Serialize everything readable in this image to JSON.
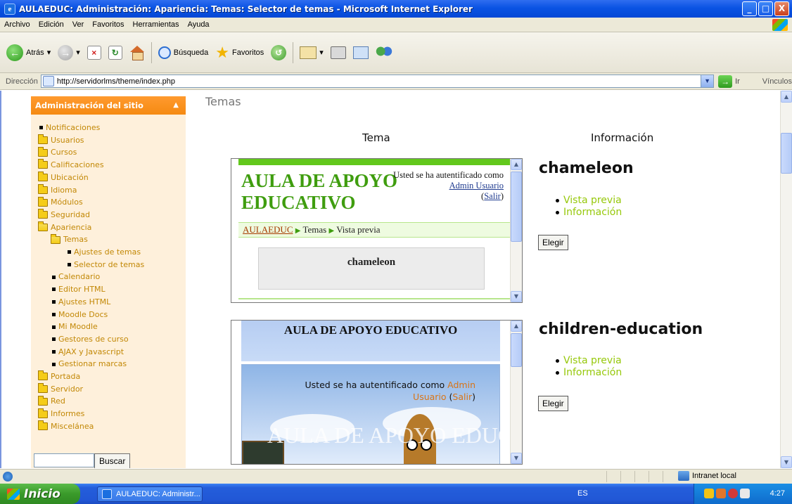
{
  "window": {
    "title": "AULAEDUC: Administración: Apariencia: Temas: Selector de temas - Microsoft Internet Explorer",
    "buttons": {
      "minimize": "_",
      "maximize": "□",
      "close": "X"
    }
  },
  "menu": [
    "Archivo",
    "Edición",
    "Ver",
    "Favoritos",
    "Herramientas",
    "Ayuda"
  ],
  "toolbar": {
    "back_label": "Atrás",
    "search_label": "Búsqueda",
    "favorites_label": "Favoritos"
  },
  "address": {
    "label": "Dirección",
    "url": "http://servidorlms/theme/index.php",
    "go_label": "Ir",
    "links_label": "Vínculos"
  },
  "sidebar": {
    "title": "Administración del sitio",
    "items": [
      {
        "label": "Notificaciones",
        "icon": "bullet",
        "level": 0
      },
      {
        "label": "Usuarios",
        "icon": "folder",
        "level": 0
      },
      {
        "label": "Cursos",
        "icon": "folder",
        "level": 0
      },
      {
        "label": "Calificaciones",
        "icon": "folder",
        "level": 0
      },
      {
        "label": "Ubicación",
        "icon": "folder",
        "level": 0
      },
      {
        "label": "Idioma",
        "icon": "folder",
        "level": 0
      },
      {
        "label": "Módulos",
        "icon": "folder",
        "level": 0
      },
      {
        "label": "Seguridad",
        "icon": "folder",
        "level": 0
      },
      {
        "label": "Apariencia",
        "icon": "folder-open",
        "level": 0
      },
      {
        "label": "Temas",
        "icon": "folder-open",
        "level": 1
      },
      {
        "label": "Ajustes de temas",
        "icon": "bullet",
        "level": 2
      },
      {
        "label": "Selector de temas",
        "icon": "bullet",
        "level": 2
      },
      {
        "label": "Calendario",
        "icon": "bullet",
        "level": 1
      },
      {
        "label": "Editor HTML",
        "icon": "bullet",
        "level": 1
      },
      {
        "label": "Ajustes HTML",
        "icon": "bullet",
        "level": 1
      },
      {
        "label": "Moodle Docs",
        "icon": "bullet",
        "level": 1
      },
      {
        "label": "Mi Moodle",
        "icon": "bullet",
        "level": 1
      },
      {
        "label": "Gestores de curso",
        "icon": "bullet",
        "level": 1
      },
      {
        "label": "AJAX y Javascript",
        "icon": "bullet",
        "level": 1
      },
      {
        "label": "Gestionar marcas",
        "icon": "bullet",
        "level": 1
      },
      {
        "label": "Portada",
        "icon": "folder",
        "level": 0
      },
      {
        "label": "Servidor",
        "icon": "folder",
        "level": 0
      },
      {
        "label": "Red",
        "icon": "folder",
        "level": 0
      },
      {
        "label": "Informes",
        "icon": "folder",
        "level": 0
      },
      {
        "label": "Miscelánea",
        "icon": "folder",
        "level": 0
      }
    ],
    "search_button": "Buscar"
  },
  "main": {
    "heading": "Temas",
    "col_theme": "Tema",
    "col_info": "Información",
    "themes": [
      {
        "name": "chameleon",
        "links": [
          "Vista previa",
          "Información"
        ],
        "choose": "Elegir",
        "preview": {
          "logo": "AULA DE APOYO EDUCATIVO",
          "auth_prefix": "Usted se ha autentificado como",
          "user": "Admin Usuario",
          "logout": "Salir",
          "breadcrumb": [
            "AULAEDUC",
            "Temas",
            "Vista previa"
          ],
          "box_title": "chameleon"
        }
      },
      {
        "name": "children-education",
        "links": [
          "Vista previa",
          "Información"
        ],
        "choose": "Elegir",
        "preview": {
          "header": "AULA DE APOYO EDUCATIVO",
          "auth_prefix": "Usted se ha autentificado como",
          "user_first": "Admin",
          "user_second": "Usuario",
          "logout": "Salir",
          "ghost_text": "AULA DE APOYO EDUCATIVO"
        }
      }
    ]
  },
  "status": {
    "zone": "Intranet local"
  },
  "taskbar": {
    "start": "Inicio",
    "task": "AULAEDUC: Administr...",
    "lang": "ES",
    "clock": "4:27"
  }
}
